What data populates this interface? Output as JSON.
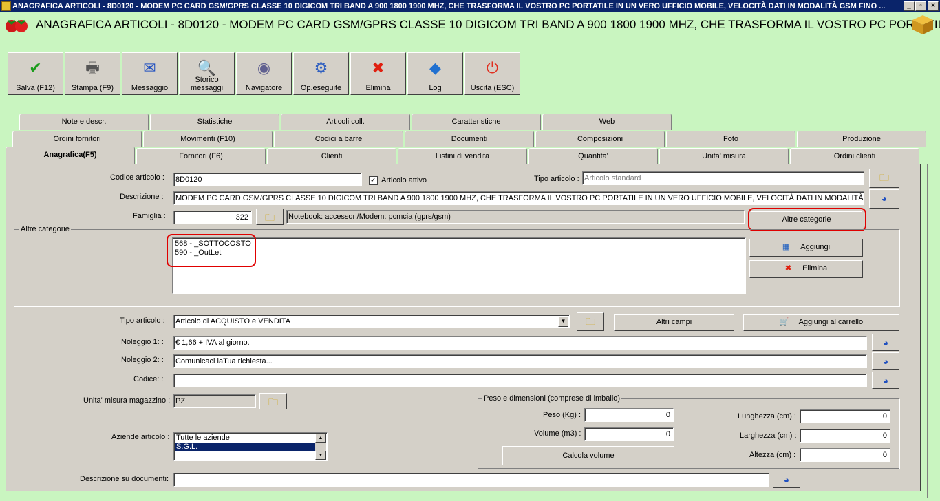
{
  "window": {
    "title": "ANAGRAFICA ARTICOLI - 8D0120 - MODEM PC CARD GSM/GPRS CLASSE 10 DIGICOM TRI BAND A 900 1800 1900 MHZ, CHE TRASFORMA IL VOSTRO PC PORTATILE IN UN VERO UFFICIO MOBILE, VELOCITÀ DATI IN MODALITÀ GSM FINO ...",
    "min": "_",
    "max": "▫",
    "close": "×"
  },
  "header": {
    "title": "ANAGRAFICA ARTICOLI - 8D0120 - MODEM PC CARD GSM/GPRS CLASSE 10 DIGICOM TRI BAND A 900 1800 1900 MHZ, CHE TRASFORMA IL VOSTRO PC PORTATILE"
  },
  "toolbar": [
    {
      "label": "Salva (F12)",
      "icon": "✔",
      "color": "#1a9c1a"
    },
    {
      "label": "Stampa (F9)",
      "icon": "🖶",
      "color": "#555"
    },
    {
      "label": "Messaggio",
      "icon": "✉",
      "color": "#2050c0"
    },
    {
      "label": "Storico messaggi",
      "icon": "🔍",
      "color": "#2050c0"
    },
    {
      "label": "Navigatore",
      "icon": "◉",
      "color": "#606090"
    },
    {
      "label": "Op.eseguite",
      "icon": "⚙",
      "color": "#3060c0"
    },
    {
      "label": "Elimina",
      "icon": "✖",
      "color": "#e02010"
    },
    {
      "label": "Log",
      "icon": "◆",
      "color": "#2070d0"
    },
    {
      "label": "Uscita (ESC)",
      "icon": "⏻",
      "color": "#e03020"
    }
  ],
  "tabs": {
    "row1": [
      "Note e descr.",
      "Statistiche",
      "Articoli coll.",
      "Caratteristiche",
      "Web"
    ],
    "row2": [
      "Ordini fornitori",
      "Movimenti (F10)",
      "Codici a barre",
      "Documenti",
      "Composizioni",
      "Foto",
      "Produzione"
    ],
    "row3": [
      "Anagrafica(F5)",
      "Fornitori (F6)",
      "Clienti",
      "Listini di vendita",
      "Quantita'",
      "Unita' misura",
      "Ordini clienti"
    ]
  },
  "form": {
    "codice_label": "Codice articolo :",
    "codice_value": "8D0120",
    "attivo_label": "Articolo attivo",
    "tipo_art_label": "Tipo articolo :",
    "tipo_art_value": "Articolo standard",
    "descr_label": "Descrizione :",
    "descr_value": "MODEM PC CARD GSM/GPRS CLASSE 10 DIGICOM TRI BAND A 900 1800 1900 MHZ, CHE TRASFORMA IL VOSTRO PC PORTATILE IN UN VERO UFFICIO MOBILE, VELOCITÀ DATI IN MODALITÀ GSM",
    "famiglia_label": "Famiglia :",
    "famiglia_value": "322",
    "famiglia_desc": "Notebook: accessori/Modem: pcmcia (gprs/gsm)",
    "altre_cat_button": "Altre categorie",
    "altre_cat_group": "Altre categorie",
    "categorie": [
      "568 - _SOTTOCOSTO",
      "590 - _OutLet"
    ],
    "aggiungi": "Aggiungi",
    "elimina": "Elimina",
    "tipo_label": "Tipo articolo :",
    "tipo_value": "Articolo di ACQUISTO e VENDITA",
    "altri_campi": "Altri campi",
    "aggiungi_carrello": "Aggiungi al carrello",
    "noleggio1_label": "Noleggio 1: :",
    "noleggio1_value": "€ 1,66 + IVA al giorno.",
    "noleggio2_label": "Noleggio 2: :",
    "noleggio2_value": "Comunicaci laTua richiesta...",
    "codice2_label": "Codice: :",
    "codice2_value": "",
    "um_label": "Unita' misura magazzino :",
    "um_value": "PZ",
    "aziende_label": "Aziende articolo :",
    "aziende": [
      "Tutte le aziende",
      "S.G.L."
    ],
    "descr_doc_label": "Descrizione su documenti:",
    "descr_doc_value": "",
    "peso_group": "Peso e dimensioni (comprese di imballo)",
    "peso_label": "Peso (Kg) :",
    "peso_value": "0",
    "volume_label": "Volume (m3) :",
    "volume_value": "0",
    "calcola": "Calcola volume",
    "lunghezza_label": "Lunghezza (cm) :",
    "lunghezza_value": "0",
    "larghezza_label": "Larghezza (cm) :",
    "larghezza_value": "0",
    "altezza_label": "Altezza (cm) :",
    "altezza_value": "0"
  }
}
